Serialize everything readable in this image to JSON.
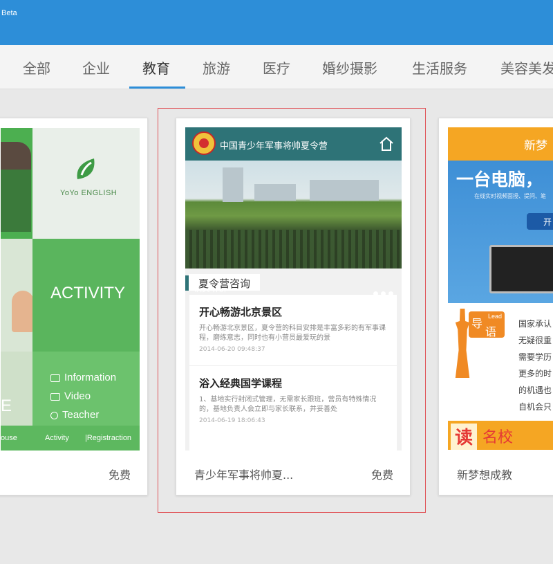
{
  "header": {
    "badge": "Beta",
    "bg_color": "#2d8ed8"
  },
  "tabs": [
    {
      "label": "全部"
    },
    {
      "label": "企业"
    },
    {
      "label": "教育",
      "active": true
    },
    {
      "label": "旅游"
    },
    {
      "label": "医疗"
    },
    {
      "label": "婚纱摄影"
    },
    {
      "label": "生活服务"
    },
    {
      "label": "美容美发"
    }
  ],
  "cards": {
    "left": {
      "price": "免费",
      "preview": {
        "logo_text": "YoYo ENGLISH",
        "banner": "ACTIVITY",
        "menu": [
          "Information",
          "Video",
          "Teacher"
        ],
        "bottom_nav": [
          "ouse",
          "Activity",
          "|Registraction"
        ],
        "partial_letter": "E"
      }
    },
    "middle": {
      "title": "青少年军事将帅夏...",
      "price": "免费",
      "selected": true,
      "preview": {
        "site_title": "中国青少年军事将帅夏令营",
        "photo_caption": "认真听讲",
        "section_label": "夏令营咨询",
        "news": [
          {
            "heading": "开心畅游北京景区",
            "summary": "开心畅游北京景区，夏令营的科目安排是丰富多彩的有军事课程，磨练意志，同时也有小营员最爱玩的景",
            "date": "2014-06-20 09:48:37"
          },
          {
            "heading": "浴入经典国学课程",
            "summary": "1、基地实行封闭式管理，无需家长跟班，营员有特殊情况的，基地负责人会立即与家长联系，并妥善处",
            "date": "2014-06-19 18:06:43"
          }
        ]
      }
    },
    "right": {
      "title": "新梦想成教",
      "preview": {
        "top_text": "新梦",
        "big_text": "一台电脑，",
        "small_text": "在线实时视频面授、提问、笔",
        "button": "开",
        "badge_cn1": "导",
        "badge_en": "Lead",
        "badge_cn2": "语",
        "lines": [
          "国家承认",
          "无疑很重",
          "需要学历",
          "更多的时",
          "的机遇也",
          "自机会只"
        ],
        "bottom_char": "读",
        "bottom_text": "名校"
      }
    }
  }
}
